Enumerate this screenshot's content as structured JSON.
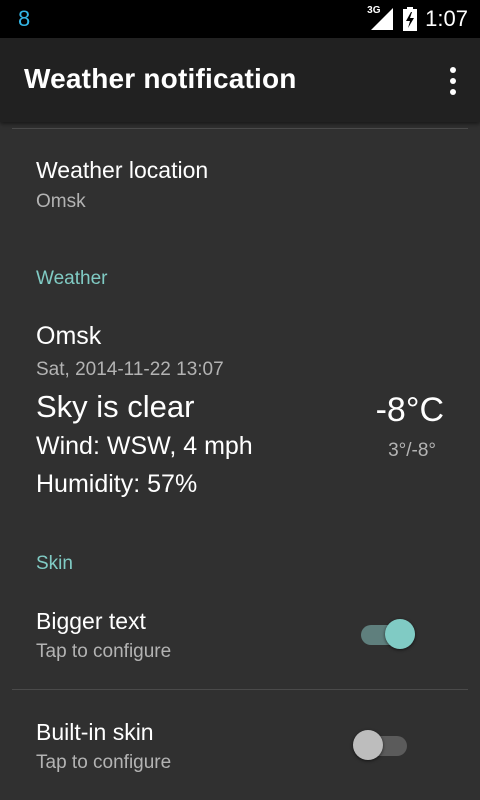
{
  "status_bar": {
    "notification_text": "8",
    "network_label": "3G",
    "time": "1:07"
  },
  "app_bar": {
    "title": "Weather notification",
    "overflow_icon": "more-vert-icon"
  },
  "preferences": {
    "weather_location": {
      "title": "Weather location",
      "summary": "Omsk"
    },
    "weather_section": {
      "header": "Weather",
      "city": "Omsk",
      "datetime": "Sat, 2014-11-22 13:07",
      "description": "Sky is clear",
      "wind": "Wind: WSW, 4 mph",
      "humidity": "Humidity: 57%",
      "temperature": "-8°C",
      "temp_range": "3°/-8°"
    },
    "skin_section": {
      "header": "Skin",
      "bigger_text": {
        "title": "Bigger text",
        "summary": "Tap to configure",
        "enabled": true
      },
      "builtin_skin": {
        "title": "Built-in skin",
        "summary": "Tap to configure",
        "enabled": false
      }
    }
  },
  "colors": {
    "accent": "#80cbc4",
    "background": "#303030",
    "app_bar": "#212121",
    "status_bar": "#000000"
  }
}
